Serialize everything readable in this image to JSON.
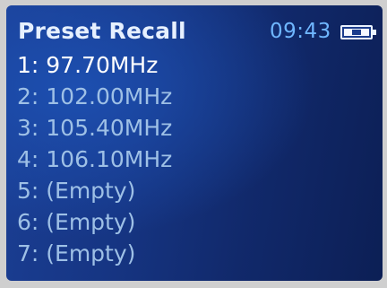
{
  "header": {
    "title": "Preset Recall",
    "time": "09:43",
    "battery_icon": "battery-icon"
  },
  "presets": [
    {
      "label": "1: 97.70MHz",
      "selected": true
    },
    {
      "label": "2: 102.00MHz",
      "selected": false
    },
    {
      "label": "3: 105.40MHz",
      "selected": false
    },
    {
      "label": "4: 106.10MHz",
      "selected": false
    },
    {
      "label": "5: (Empty)",
      "selected": false
    },
    {
      "label": "6: (Empty)",
      "selected": false
    },
    {
      "label": "7: (Empty)",
      "selected": false
    }
  ],
  "colors": {
    "screen_bg": "#163583",
    "title": "#e6f0ff",
    "clock": "#6fb6ff",
    "item": "#9ec0e6",
    "item_selected": "#ffffff"
  }
}
